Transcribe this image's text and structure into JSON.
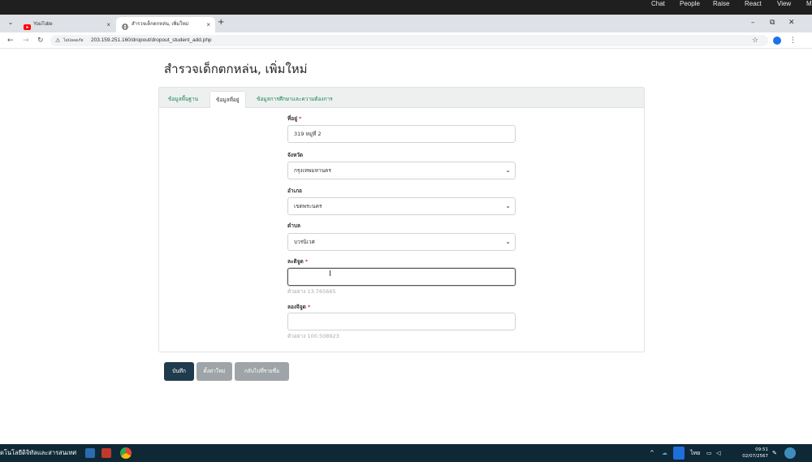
{
  "meeting_bar": {
    "items": [
      "Chat",
      "People",
      "Raise",
      "React",
      "View",
      "M"
    ]
  },
  "browser": {
    "tabs": [
      {
        "title": "YouTube",
        "close": "×"
      },
      {
        "title": "สำรวจเด็กตกหล่น, เพิ่มใหม่",
        "close": "×"
      }
    ],
    "new_tab": "+",
    "window_controls": {
      "minimize": "–",
      "restore": "⧉",
      "close": "✕"
    },
    "not_secure": "ไม่ปลอดภัย",
    "url": "203.159.251.160/dropout/dropout_student_add.php"
  },
  "page": {
    "title": "สำรวจเด็กตกหล่น, เพิ่มใหม่",
    "tabs": [
      "ข้อมูลพื้นฐาน",
      "ข้อมูลที่อยู่",
      "ข้อมูลการศึกษาและความต้องการ"
    ],
    "active_tab": 1,
    "form": {
      "address": {
        "label": "ที่อยู่",
        "required": "*",
        "value": "319 หมู่ที่ 2"
      },
      "province": {
        "label": "จังหวัด",
        "value": "กรุงเทพมหานคร"
      },
      "district": {
        "label": "อำเภอ",
        "value": "เขตพระนคร"
      },
      "subdistrict": {
        "label": "ตำบล",
        "value": "บวรนิเวศ"
      },
      "latitude": {
        "label": "ละติจูด",
        "required": "*",
        "value": "",
        "help": "ตัวอย่าง 13.765665"
      },
      "longitude": {
        "label": "ลองจิจูด",
        "required": "*",
        "value": "",
        "help": "ตัวอย่าง 100.508923"
      }
    },
    "buttons": {
      "save": "บันทึก",
      "reset": "ตั้งค่าใหม่",
      "back": "กลับไปที่รายชื่อ"
    }
  },
  "taskbar": {
    "text": "ดโนโลยีดิจิทัลและสารสนเทศ",
    "language": "ไทย",
    "time": "09:51",
    "date": "02/07/2567"
  },
  "colors": {
    "tab_link": "#198754",
    "save_button": "#1f3b4d",
    "secondary_button": "#9ea4a7",
    "required": "#dc3545",
    "taskbar": "#0e2836"
  }
}
